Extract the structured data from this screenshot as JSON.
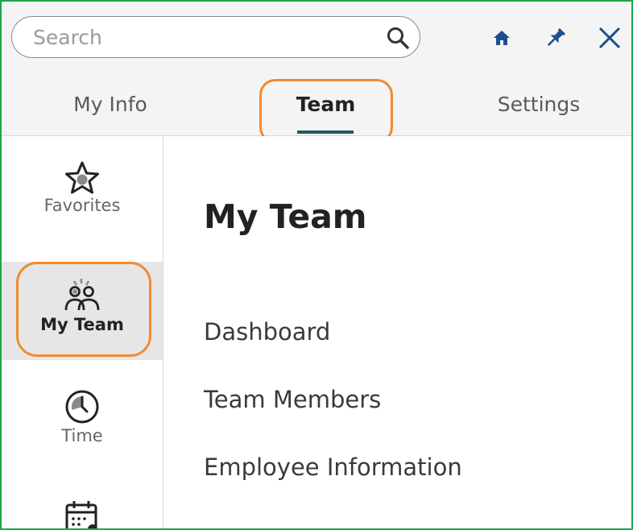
{
  "header": {
    "search": {
      "placeholder": "Search",
      "value": ""
    },
    "icons": [
      "search-icon",
      "home-icon",
      "pin-icon",
      "close-icon"
    ]
  },
  "tabs": [
    {
      "label": "My Info",
      "active": false
    },
    {
      "label": "Team",
      "active": true
    },
    {
      "label": "Settings",
      "active": false
    }
  ],
  "sidebar": {
    "items": [
      {
        "label": "Favorites",
        "icon": "star-icon",
        "active": false
      },
      {
        "label": "My Team",
        "icon": "team-icon",
        "active": true
      },
      {
        "label": "Time",
        "icon": "clock-icon",
        "active": false
      },
      {
        "label": "",
        "icon": "calendar-icon",
        "active": false
      }
    ]
  },
  "main": {
    "title": "My Team",
    "links": [
      "Dashboard",
      "Team Members",
      "Employee Information"
    ]
  },
  "colors": {
    "accent_underline": "#1c5b62",
    "callout": "#f28a2e",
    "frame_border": "#1fa64a",
    "header_bg": "#f4f4f4",
    "active_side_bg": "#e6e6e6"
  }
}
